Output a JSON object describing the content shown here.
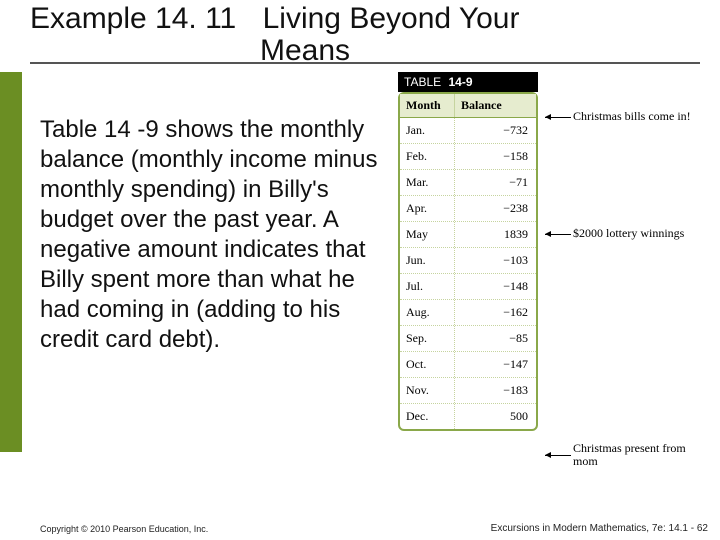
{
  "title": {
    "prefix": "Example 14. 11",
    "rest": "Living Beyond Your",
    "line2": "Means"
  },
  "body": "Table 14 -9 shows the monthly balance (monthly income minus monthly spending) in Billy's budget over the past year. A negative amount indicates that Billy spent more than what he had coming in (adding to his credit card debt).",
  "copyright": "Copyright © 2010 Pearson Education, Inc.",
  "footer_right": "Excursions in Modern Mathematics, 7e: 14.1 - 62",
  "table": {
    "caption_label": "TABLE",
    "caption_num": "14-9",
    "head_month": "Month",
    "head_balance": "Balance",
    "rows": [
      {
        "m": "Jan.",
        "b": "−732"
      },
      {
        "m": "Feb.",
        "b": "−158"
      },
      {
        "m": "Mar.",
        "b": "−71"
      },
      {
        "m": "Apr.",
        "b": "−238"
      },
      {
        "m": "May",
        "b": "1839"
      },
      {
        "m": "Jun.",
        "b": "−103"
      },
      {
        "m": "Jul.",
        "b": "−148"
      },
      {
        "m": "Aug.",
        "b": "−162"
      },
      {
        "m": "Sep.",
        "b": "−85"
      },
      {
        "m": "Oct.",
        "b": "−147"
      },
      {
        "m": "Nov.",
        "b": "−183"
      },
      {
        "m": "Dec.",
        "b": "500"
      }
    ]
  },
  "annotations": {
    "a0": "Christmas bills come in!",
    "a1": "$2000 lottery winnings",
    "a2": "Christmas present from mom"
  }
}
